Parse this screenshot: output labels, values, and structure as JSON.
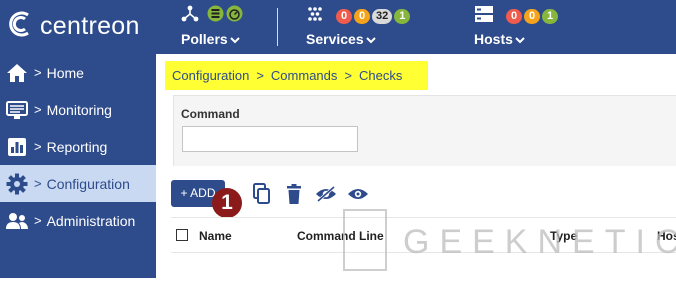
{
  "brand": {
    "name": "centreon"
  },
  "topbar": {
    "pollers": {
      "label": "Pollers"
    },
    "services": {
      "label": "Services",
      "counts": [
        "0",
        "0",
        "32",
        "1"
      ]
    },
    "hosts": {
      "label": "Hosts",
      "counts": [
        "0",
        "0",
        "1"
      ]
    }
  },
  "sidebar": {
    "items": [
      {
        "label": "Home",
        "icon": "home-icon"
      },
      {
        "label": "Monitoring",
        "icon": "monitor-icon"
      },
      {
        "label": "Reporting",
        "icon": "chart-icon"
      },
      {
        "label": "Configuration",
        "icon": "gear-icon",
        "active": true
      },
      {
        "label": "Administration",
        "icon": "users-icon"
      }
    ]
  },
  "breadcrumb": {
    "items": [
      "Configuration",
      "Commands",
      "Checks"
    ]
  },
  "filter": {
    "label": "Command",
    "value": ""
  },
  "toolbar": {
    "add_label": "+ ADD"
  },
  "annotation": {
    "number": "1"
  },
  "table": {
    "columns": [
      "Name",
      "Command Line",
      "Type",
      "Hos"
    ]
  },
  "watermark": {
    "text": "GEEKNETIC"
  },
  "colors": {
    "brand": "#2e4c8c",
    "highlight": "#ffff33",
    "badge": "#8b1a1a"
  }
}
